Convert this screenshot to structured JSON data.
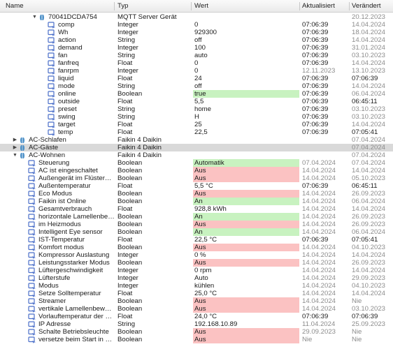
{
  "header": {
    "name": "Name",
    "type": "Typ",
    "value": "Wert",
    "updated": "Aktualisiert",
    "changed": "Verändert"
  },
  "colors": {
    "false_bg": "#fbc2c2",
    "true_bg": "#c8f2c0",
    "selected_row": "#d9d9d9",
    "folder_icon": "#4a8fc7",
    "state_icon": "#4b6fc9"
  },
  "rows": [
    {
      "indent": 3,
      "toggle": "open",
      "icon": "device",
      "name": "70041DCDA754",
      "type": "MQTT Server Gerät",
      "value": "",
      "updated": "",
      "changed": "20.12.2023",
      "changed_old": true
    },
    {
      "indent": 4,
      "icon": "state",
      "name": "comp",
      "type": "Integer",
      "value": "0",
      "updated": "07:06:39",
      "changed": "14.04.2024",
      "changed_old": true
    },
    {
      "indent": 4,
      "icon": "state",
      "name": "Wh",
      "type": "Integer",
      "value": "929300",
      "updated": "07:06:39",
      "changed": "18.04.2024",
      "changed_old": true
    },
    {
      "indent": 4,
      "icon": "state",
      "name": "action",
      "type": "String",
      "value": "off",
      "updated": "07:06:39",
      "changed": "14.04.2024",
      "changed_old": true
    },
    {
      "indent": 4,
      "icon": "state",
      "name": "demand",
      "type": "Integer",
      "value": "100",
      "updated": "07:06:39",
      "changed": "31.01.2024",
      "changed_old": true
    },
    {
      "indent": 4,
      "icon": "state",
      "name": "fan",
      "type": "String",
      "value": "auto",
      "updated": "07:06:39",
      "changed": "03.10.2023",
      "changed_old": true
    },
    {
      "indent": 4,
      "icon": "state",
      "name": "fanfreq",
      "type": "Float",
      "value": "0",
      "updated": "07:06:39",
      "changed": "14.04.2024",
      "changed_old": true
    },
    {
      "indent": 4,
      "icon": "state",
      "name": "fanrpm",
      "type": "Integer",
      "value": "0",
      "updated": "12.11.2023",
      "updated_old": true,
      "changed": "13.10.2023",
      "changed_old": true
    },
    {
      "indent": 4,
      "icon": "state",
      "name": "liquid",
      "type": "Float",
      "value": "24",
      "updated": "07:06:39",
      "changed": "07:06:39"
    },
    {
      "indent": 4,
      "icon": "state",
      "name": "mode",
      "type": "String",
      "value": "off",
      "updated": "07:06:39",
      "changed": "14.04.2024",
      "changed_old": true
    },
    {
      "indent": 4,
      "icon": "state",
      "name": "online",
      "type": "Boolean",
      "value": "true",
      "bg": "green",
      "updated": "07:06:39",
      "changed": "06.04.2024",
      "changed_old": true
    },
    {
      "indent": 4,
      "icon": "state",
      "name": "outside",
      "type": "Float",
      "value": "5,5",
      "updated": "07:06:39",
      "changed": "06:45:11"
    },
    {
      "indent": 4,
      "icon": "state",
      "name": "preset",
      "type": "String",
      "value": "home",
      "updated": "07:06:39",
      "changed": "03.10.2023",
      "changed_old": true
    },
    {
      "indent": 4,
      "icon": "state",
      "name": "swing",
      "type": "String",
      "value": "H",
      "updated": "07:06:39",
      "changed": "03.10.2023",
      "changed_old": true
    },
    {
      "indent": 4,
      "icon": "state",
      "name": "target",
      "type": "Float",
      "value": "25",
      "updated": "07:06:39",
      "changed": "14.04.2024",
      "changed_old": true
    },
    {
      "indent": 4,
      "icon": "state",
      "name": "temp",
      "type": "Float",
      "value": "22,5",
      "updated": "07:06:39",
      "changed": "07:05:41"
    },
    {
      "indent": 1,
      "toggle": "closed",
      "icon": "device",
      "name": "AC-Schlafen",
      "type": "Faikin 4 Daikin",
      "value": "",
      "updated": "",
      "changed": "07.04.2024",
      "changed_old": true
    },
    {
      "indent": 1,
      "toggle": "closed",
      "icon": "device",
      "name": "AC-Gäste",
      "type": "Faikin 4 Daikin",
      "value": "",
      "updated": "",
      "changed": "07.04.2024",
      "changed_old": true,
      "selected": true
    },
    {
      "indent": 1,
      "toggle": "open",
      "icon": "device",
      "name": "AC-Wohnen",
      "type": "Faikin 4 Daikin",
      "value": "",
      "updated": "",
      "changed": "07.04.2024",
      "changed_old": true
    },
    {
      "indent": 2,
      "icon": "state",
      "name": "Steuerung",
      "type": "Boolean",
      "value": "Automatik",
      "bg": "green",
      "updated": "07.04.2024",
      "updated_old": true,
      "changed": "07.04.2024",
      "changed_old": true
    },
    {
      "indent": 2,
      "icon": "state",
      "name": "AC ist eingeschaltet",
      "type": "Boolean",
      "value": "Aus",
      "bg": "red",
      "updated": "14.04.2024",
      "updated_old": true,
      "changed": "14.04.2024",
      "changed_old": true
    },
    {
      "indent": 2,
      "icon": "state",
      "name": "Außengerät im Flüsterbetrieb",
      "type": "Boolean",
      "value": "Aus",
      "bg": "red",
      "updated": "14.04.2024",
      "updated_old": true,
      "changed": "05.10.2023",
      "changed_old": true
    },
    {
      "indent": 2,
      "icon": "state",
      "name": "Außentemperatur",
      "type": "Float",
      "value": "5,5 °C",
      "updated": "07:06:39",
      "changed": "06:45:11"
    },
    {
      "indent": 2,
      "icon": "state",
      "name": "Eco Modus",
      "type": "Boolean",
      "value": "Aus",
      "bg": "red",
      "updated": "14.04.2024",
      "updated_old": true,
      "changed": "26.09.2023",
      "changed_old": true
    },
    {
      "indent": 2,
      "icon": "state",
      "name": "Faikin ist Online",
      "type": "Boolean",
      "value": "An",
      "bg": "green",
      "updated": "14.04.2024",
      "updated_old": true,
      "changed": "06.04.2024",
      "changed_old": true
    },
    {
      "indent": 2,
      "icon": "state",
      "name": "Gesamtverbrauch",
      "type": "Float",
      "value": "928,8 kWh",
      "updated": "14.04.2024",
      "updated_old": true,
      "changed": "14.04.2024",
      "changed_old": true
    },
    {
      "indent": 2,
      "icon": "state",
      "name": "horizontale Lamellenbewegung",
      "type": "Boolean",
      "value": "An",
      "bg": "green",
      "updated": "14.04.2024",
      "updated_old": true,
      "changed": "26.09.2023",
      "changed_old": true
    },
    {
      "indent": 2,
      "icon": "state",
      "name": "im Heizmodus",
      "type": "Boolean",
      "value": "Aus",
      "bg": "red",
      "updated": "14.04.2024",
      "updated_old": true,
      "changed": "26.09.2023",
      "changed_old": true
    },
    {
      "indent": 2,
      "icon": "state",
      "name": "Intelligent Eye sensor",
      "type": "Boolean",
      "value": "An",
      "bg": "green",
      "updated": "14.04.2024",
      "updated_old": true,
      "changed": "06.04.2024",
      "changed_old": true
    },
    {
      "indent": 2,
      "icon": "state",
      "name": "IST-Temperatur",
      "type": "Float",
      "value": "22,5 °C",
      "updated": "07:06:39",
      "changed": "07:05:41"
    },
    {
      "indent": 2,
      "icon": "state",
      "name": "Komfort modus",
      "type": "Boolean",
      "value": "Aus",
      "bg": "red",
      "updated": "14.04.2024",
      "updated_old": true,
      "changed": "04.10.2023",
      "changed_old": true
    },
    {
      "indent": 2,
      "icon": "state",
      "name": "Kompressor Auslastung",
      "type": "Integer",
      "value": "0 %",
      "updated": "14.04.2024",
      "updated_old": true,
      "changed": "14.04.2024",
      "changed_old": true
    },
    {
      "indent": 2,
      "icon": "state",
      "name": "Leistungsstarker Modus",
      "type": "Boolean",
      "value": "Aus",
      "bg": "red",
      "updated": "14.04.2024",
      "updated_old": true,
      "changed": "26.09.2023",
      "changed_old": true
    },
    {
      "indent": 2,
      "icon": "state",
      "name": "Lüftergeschwindigkeit",
      "type": "Integer",
      "value": "0 rpm",
      "updated": "14.04.2024",
      "updated_old": true,
      "changed": "14.04.2024",
      "changed_old": true
    },
    {
      "indent": 2,
      "icon": "state",
      "name": "Lüfterstufe",
      "type": "Integer",
      "value": "Auto",
      "updated": "14.04.2024",
      "updated_old": true,
      "changed": "29.09.2023",
      "changed_old": true
    },
    {
      "indent": 2,
      "icon": "state",
      "name": "Modus",
      "type": "Integer",
      "value": "kühlen",
      "updated": "14.04.2024",
      "updated_old": true,
      "changed": "04.10.2023",
      "changed_old": true
    },
    {
      "indent": 2,
      "icon": "state",
      "name": "Setze Solltemperatur",
      "type": "Float",
      "value": "25,0 °C",
      "updated": "14.04.2024",
      "updated_old": true,
      "changed": "14.04.2024",
      "changed_old": true
    },
    {
      "indent": 2,
      "icon": "state",
      "name": "Streamer",
      "type": "Boolean",
      "value": "Aus",
      "bg": "red",
      "updated": "14.04.2024",
      "updated_old": true,
      "changed": "Nie",
      "changed_old": true
    },
    {
      "indent": 2,
      "icon": "state",
      "name": "vertikale Lamellenbewegung",
      "type": "Boolean",
      "value": "Aus",
      "bg": "red",
      "updated": "14.04.2024",
      "updated_old": true,
      "changed": "03.10.2023",
      "changed_old": true
    },
    {
      "indent": 2,
      "icon": "state",
      "name": "Vorlauftemperatur der Flüssigkeit",
      "type": "Float",
      "value": "24,0 °C",
      "updated": "07:06:39",
      "changed": "07:06:39"
    },
    {
      "indent": 2,
      "icon": "state",
      "name": "IP Adresse",
      "type": "String",
      "value": "192.168.10.89",
      "updated": "11.04.2024",
      "updated_old": true,
      "changed": "25.09.2023",
      "changed_old": true
    },
    {
      "indent": 2,
      "icon": "state",
      "name": "Schalte Betriebsleuchte",
      "type": "Boolean",
      "value": "Aus",
      "bg": "red",
      "updated": "29.09.2023",
      "updated_old": true,
      "changed": "Nie",
      "changed_old": true
    },
    {
      "indent": 2,
      "icon": "state",
      "name": "versetze beim Start in den Standby",
      "type": "Boolean",
      "value": "Aus",
      "bg": "red",
      "updated": "Nie",
      "updated_old": true,
      "changed": "Nie",
      "changed_old": true
    }
  ]
}
